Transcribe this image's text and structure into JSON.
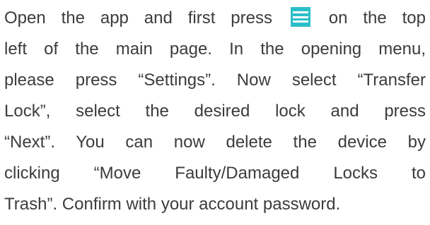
{
  "instruction": {
    "line1_before_icon": "Open the app and first press",
    "menu_icon": "hamburger-menu-icon",
    "line1_after_icon": "on the top",
    "line2": "left of the main page. In the opening menu,",
    "line3": "please press “Settings”. Now select “Transfer",
    "line4": "Lock”, select the desired lock and press",
    "line5": "“Next”. You can now delete the device by",
    "line6": "clicking “Move Faulty/Damaged Locks to",
    "line7": "Trash”. Confirm with your account password."
  },
  "colors": {
    "text": "#3c3c3c",
    "icon_background": "#2bbec8",
    "icon_bars": "#ffffff"
  }
}
